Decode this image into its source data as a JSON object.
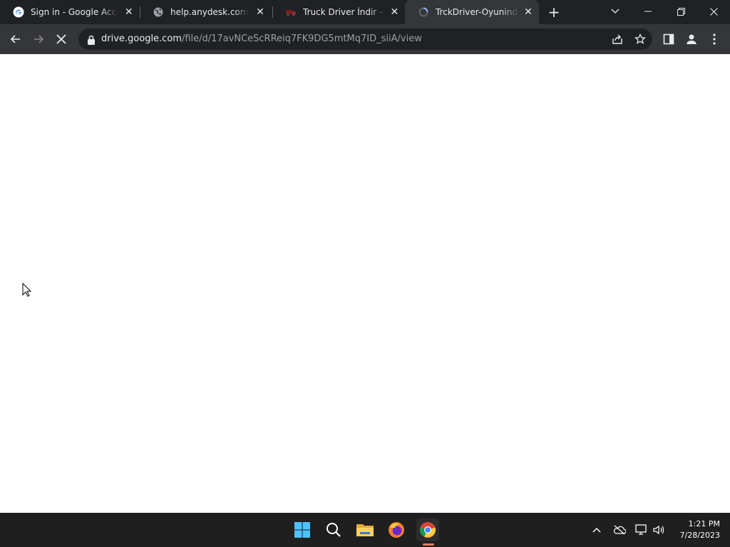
{
  "tabs": [
    {
      "label": "Sign in - Google Accounts",
      "icon": "google-icon"
    },
    {
      "label": "help.anydesk.com",
      "icon": "globe-icon"
    },
    {
      "label": "Truck Driver İndir – Full PC",
      "icon": "truck-icon"
    },
    {
      "label": "TrckDriver-Oyunindir.club",
      "icon": "loading-icon",
      "active": true
    }
  ],
  "omnibox": {
    "host": "drive.google.com",
    "path": "/file/d/17avNCeScRReiq7FK9DG5mtMq7ID_siiA/view"
  },
  "taskbar": {
    "time": "1:21 PM",
    "date": "7/28/2023",
    "apps": [
      "windows-start-icon",
      "search-icon",
      "file-explorer-icon",
      "firefox-icon",
      "chrome-icon"
    ]
  },
  "colors": {
    "tabbar_bg": "#202124",
    "toolbar_bg": "#35363a",
    "taskbar_bg": "#1f1f1f",
    "chrome_indicator": "#e97a5c"
  }
}
